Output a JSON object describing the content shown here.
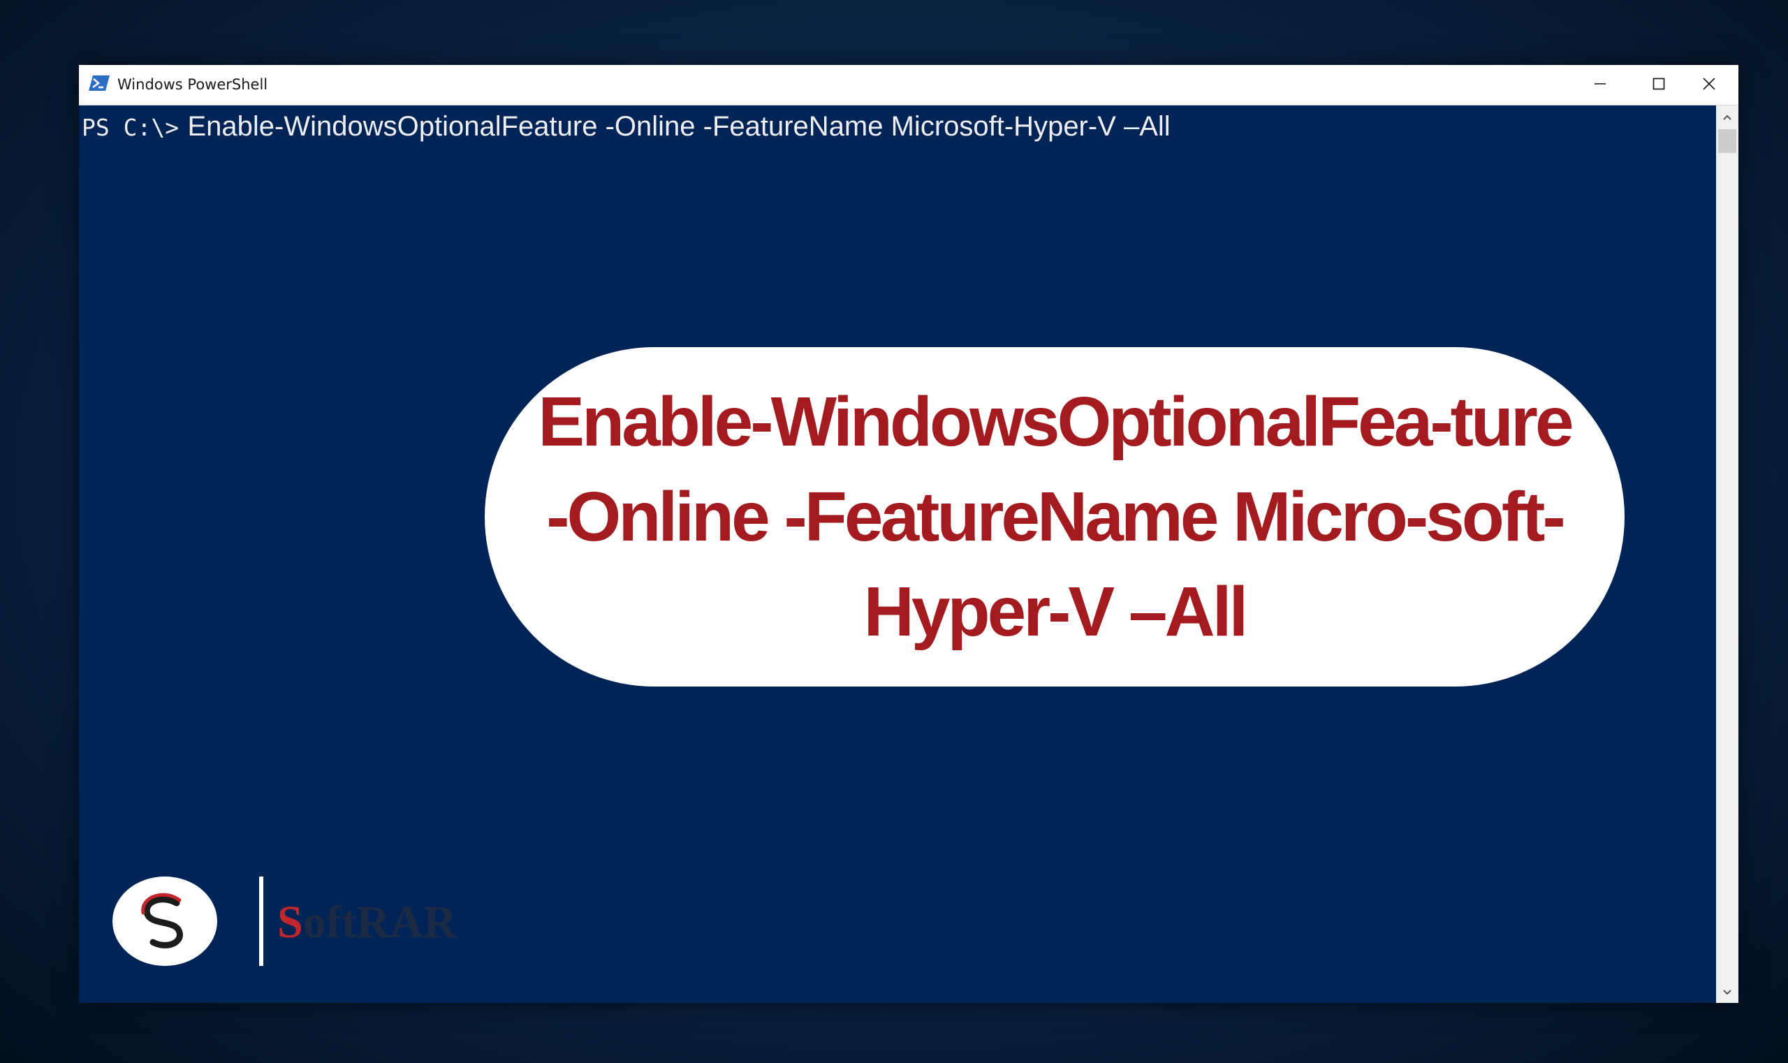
{
  "window": {
    "title": "Windows PowerShell"
  },
  "console": {
    "prompt": "PS C:\\>",
    "command": "Enable-WindowsOptionalFeature -Online -FeatureName Microsoft-Hyper-V –All"
  },
  "callout": {
    "text": "Enable-WindowsOptionalFea-ture -Online -FeatureName Micro-soft-Hyper-V –All"
  },
  "logo": {
    "initial": "S",
    "rest": "oftRAR"
  },
  "colors": {
    "console_bg": "#012456",
    "callout_text": "#a31b1f",
    "logo_red": "#c0262b"
  },
  "icons": {
    "app": "powershell-icon",
    "minimize": "minimize-icon",
    "maximize": "maximize-icon",
    "close": "close-icon",
    "scroll_up": "chevron-up-icon",
    "scroll_down": "chevron-down-icon"
  }
}
